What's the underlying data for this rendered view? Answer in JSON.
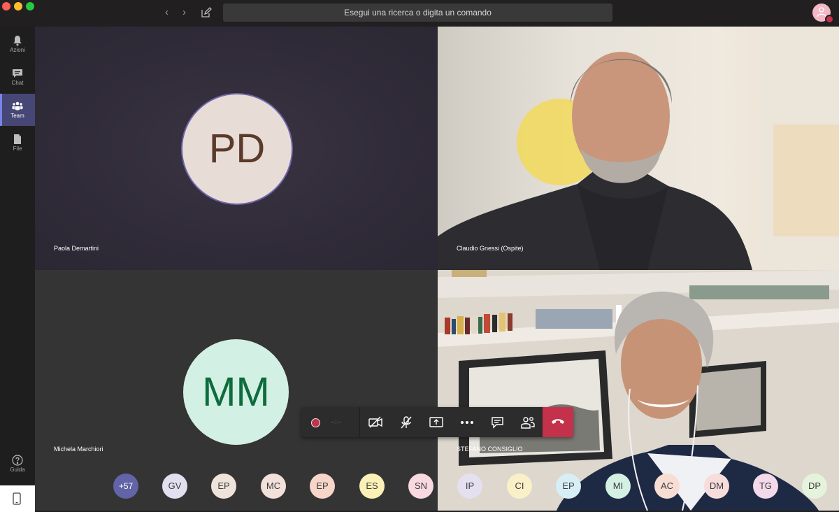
{
  "titlebar": {
    "back_glyph": "‹",
    "forward_glyph": "›",
    "search_placeholder": "Esegui una ricerca o digita un comando"
  },
  "rail": {
    "items": [
      {
        "label": "Azioni",
        "icon": "bell-icon"
      },
      {
        "label": "Chat",
        "icon": "chat-icon"
      },
      {
        "label": "Team",
        "icon": "team-icon",
        "active": true
      },
      {
        "label": "File",
        "icon": "file-icon"
      }
    ],
    "help": {
      "label": "Guida",
      "icon": "help-icon"
    }
  },
  "tiles": [
    {
      "name": "Paola Demartini",
      "initials": "PD",
      "type": "avatar"
    },
    {
      "name": "Claudio Gnessi (Ospite)",
      "type": "video"
    },
    {
      "name": "Michela Marchiori",
      "initials": "MM",
      "type": "avatar"
    },
    {
      "name": "STEFANO CONSIGLIO",
      "type": "video"
    }
  ],
  "controls": {
    "timer": "--:--"
  },
  "participants": {
    "overflow": "+57",
    "initials": [
      "GV",
      "EP",
      "MC",
      "EP",
      "ES",
      "SN",
      "IP",
      "CI",
      "EP",
      "MI",
      "AC",
      "DM",
      "TG",
      "DP"
    ]
  },
  "colors": {
    "accent": "#464775",
    "hangup": "#c4314b",
    "overflow_chip": "#6264a7"
  }
}
